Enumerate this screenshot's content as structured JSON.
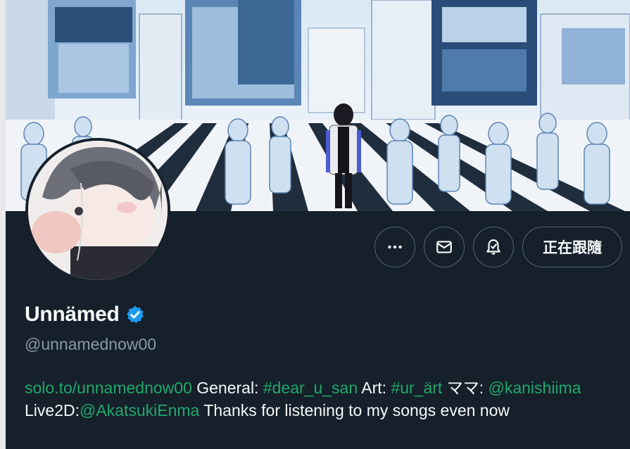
{
  "profile": {
    "display_name": "Unnämed",
    "handle": "@unnamednow00",
    "verified_icon": "verified-badge-icon"
  },
  "actions": {
    "more_icon": "more-icon",
    "message_icon": "mail-icon",
    "notify_icon": "bell-check-icon",
    "follow_label": "正在跟隨"
  },
  "bio": {
    "link": "solo.to/unnamednow00",
    "general_label": " General: ",
    "general_tag": "#dear_u_san",
    "art_label": " Art: ",
    "art_tag": "#ur_ärt",
    "mama_label": " ママ: ",
    "mention1": "@kanishiima",
    "live2d_label": " Live2D:",
    "mention2": "@AkatsukiEnma",
    "tail": " Thanks for listening to my songs even now"
  },
  "colors": {
    "background": "#15202b",
    "text": "#f7f9f9",
    "secondary": "#8b98a5",
    "link": "#21a86a",
    "verified": "#1d9bf0",
    "border": "#536471"
  }
}
